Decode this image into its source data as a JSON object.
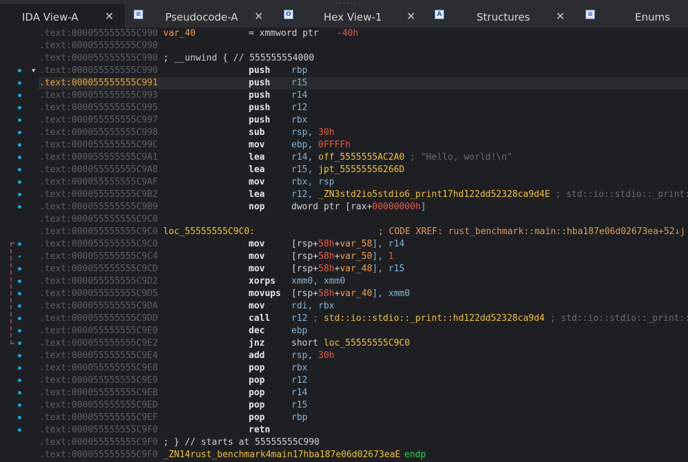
{
  "tabs": [
    {
      "label": "IDA View-A",
      "active": true,
      "icon": "graph-icon"
    },
    {
      "label": "Pseudocode-A",
      "active": false,
      "icon": "pseudocode-icon"
    },
    {
      "label": "Hex View-1",
      "active": false,
      "icon": "hex-icon"
    },
    {
      "label": "Structures",
      "active": false,
      "icon": "structures-icon"
    },
    {
      "label": "Enums",
      "active": false,
      "icon": "enums-icon"
    }
  ],
  "close_glyph": "✕",
  "lines": [
    {
      "addr": ".text:000055555555C990",
      "label": "var_40",
      "rest": "= xmmword ptr ",
      "num": "-40h"
    },
    {
      "addr": ".text:000055555555C990"
    },
    {
      "addr": ".text:000055555555C990",
      "comment": "; __unwind { // 555555554000"
    },
    {
      "addr": ".text:000055555555C990",
      "mn": "push",
      "op": "rbp"
    },
    {
      "addr": ".text:000055555555C991",
      "mn": "push",
      "op": "r15",
      "current": true
    },
    {
      "addr": ".text:000055555555C993",
      "mn": "push",
      "op": "r14"
    },
    {
      "addr": ".text:000055555555C995",
      "mn": "push",
      "op": "r12"
    },
    {
      "addr": ".text:000055555555C997",
      "mn": "push",
      "op": "rbx"
    },
    {
      "addr": ".text:000055555555C998",
      "mn": "sub",
      "op": "rsp, ",
      "num": "30h"
    },
    {
      "addr": ".text:000055555555C99C",
      "mn": "mov",
      "op": "ebp, ",
      "num": "0FFFFh"
    },
    {
      "addr": ".text:000055555555C9A1",
      "mn": "lea",
      "op": "r14, ",
      "name": "off_5555555AC2A0",
      "cmt": " ; \"Hello, world!\\n\""
    },
    {
      "addr": ".text:000055555555C9A8",
      "mn": "lea",
      "op": "r15, ",
      "name": "jpt_55555556266D"
    },
    {
      "addr": ".text:000055555555C9AF",
      "mn": "mov",
      "op": "rbx, rsp"
    },
    {
      "addr": ".text:000055555555C9B2",
      "mn": "lea",
      "op": "r12, ",
      "name": "_ZN3std2io5stdio6_print17hd122dd52328ca9d4E",
      "cmt": " ; std::io::stdio::_print::"
    },
    {
      "addr": ".text:000055555555C9B9",
      "mn": "nop",
      "op": "dword ptr [rax+",
      "num": "00000000h",
      "tail": "]"
    },
    {
      "addr": ".text:000055555555C9C0"
    },
    {
      "addr": ".text:000055555555C9C0",
      "loc": "loc_55555555C9C0:",
      "xref": "; CODE XREF: rust_benchmark::main::hba187e06d02673ea+52↓j"
    },
    {
      "addr": ".text:000055555555C9C0",
      "mn": "mov",
      "op": "[rsp+",
      "num": "58h",
      "op2": "+",
      "stk": "var_58",
      "tail": "], r14"
    },
    {
      "addr": ".text:000055555555C9C4",
      "mn": "mov",
      "op": "[rsp+",
      "num": "58h",
      "op2": "+",
      "stk": "var_50",
      "tail": "], ",
      "num2": "1"
    },
    {
      "addr": ".text:000055555555C9CD",
      "mn": "mov",
      "op": "[rsp+",
      "num": "58h",
      "op2": "+",
      "stk": "var_48",
      "tail": "], r15"
    },
    {
      "addr": ".text:000055555555C9D2",
      "mn": "xorps",
      "op": "xmm0, xmm0"
    },
    {
      "addr": ".text:000055555555C9D5",
      "mn": "movups",
      "op": "[rsp+",
      "num": "58h",
      "op2": "+",
      "stk": "var_40",
      "tail": "], xmm0"
    },
    {
      "addr": ".text:000055555555C9DA",
      "mn": "mov",
      "op": "rdi, rbx"
    },
    {
      "addr": ".text:000055555555C9DD",
      "mn": "call",
      "op": "r12 ",
      "cmt3": "; ",
      "name": "std::io::stdio::_print::hd122dd52328ca9d4",
      "cmt": " ; std::io::stdio::_print::"
    },
    {
      "addr": ".text:000055555555C9E0",
      "mn": "dec",
      "op": "ebp"
    },
    {
      "addr": ".text:000055555555C9E2",
      "mn": "jnz",
      "op": "short ",
      "name": "loc_55555555C9C0"
    },
    {
      "addr": ".text:000055555555C9E4",
      "mn": "add",
      "op": "rsp, ",
      "num": "30h"
    },
    {
      "addr": ".text:000055555555C9E8",
      "mn": "pop",
      "op": "rbx"
    },
    {
      "addr": ".text:000055555555C9E9",
      "mn": "pop",
      "op": "r12"
    },
    {
      "addr": ".text:000055555555C9EB",
      "mn": "pop",
      "op": "r14"
    },
    {
      "addr": ".text:000055555555C9ED",
      "mn": "pop",
      "op": "r15"
    },
    {
      "addr": ".text:000055555555C9EF",
      "mn": "pop",
      "op": "rbp"
    },
    {
      "addr": ".text:000055555555C9F0",
      "mn": "retn"
    },
    {
      "addr": ".text:000055555555C9F0",
      "comment": "; } // starts at 55555555C990"
    },
    {
      "addr": ".text:000055555555C9F0",
      "endp_name": "_ZN14rust_benchmark4main17hba187e06d02673eaE",
      "endp": "endp"
    }
  ]
}
